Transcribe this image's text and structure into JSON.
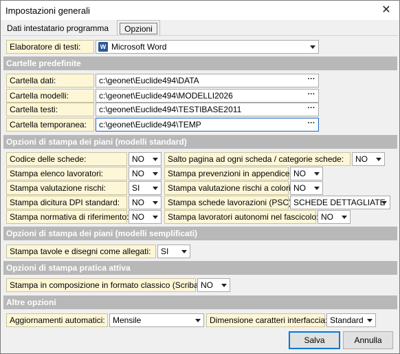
{
  "window": {
    "title": "Impostazioni generali",
    "close_glyph": "✕"
  },
  "tabs": [
    {
      "label": "Dati intestatario programma"
    },
    {
      "label": "Opzioni"
    }
  ],
  "editor": {
    "label": "Elaboratore di testi:",
    "value": "Microsoft Word",
    "icon": "word-icon",
    "icon_glyph": "W"
  },
  "sections": {
    "folders": "Cartelle predefinite",
    "print_standard": "Opzioni di stampa dei piani (modelli standard)",
    "print_simplified": "Opzioni di stampa dei piani (modelli semplificati)",
    "print_practice": "Opzioni di stampa pratica attiva",
    "other": "Altre opzioni"
  },
  "folders": [
    {
      "label": "Cartella dati:",
      "value": "c:\\geonet\\Euclide494\\DATA"
    },
    {
      "label": "Cartella modelli:",
      "value": "c:\\geonet\\Euclide494\\MODELLI2026"
    },
    {
      "label": "Cartella testi:",
      "value": "c:\\geonet\\Euclide494\\TESTIBASE2011"
    },
    {
      "label": "Cartella temporanea:",
      "value": "c:\\geonet\\Euclide494\\TEMP"
    }
  ],
  "browse_glyph": "···",
  "print_standard": {
    "left": [
      {
        "label": "Codice delle schede:",
        "value": "NO"
      },
      {
        "label": "Stampa elenco lavoratori:",
        "value": "NO"
      },
      {
        "label": "Stampa valutazione rischi:",
        "value": "SI"
      },
      {
        "label": "Stampa dicitura DPI standard:",
        "value": "NO"
      },
      {
        "label": "Stampa normativa di riferimento:",
        "value": "NO"
      }
    ],
    "right": [
      {
        "label": "Salto pagina ad ogni scheda / categorie schede:",
        "value": "NO"
      },
      {
        "label": "Stampa prevenzioni in appendice:",
        "value": "NO"
      },
      {
        "label": "Stampa valutazione rischi a colori:",
        "value": "NO"
      },
      {
        "label": "Stampa schede lavorazioni (PSC):",
        "value": "SCHEDE DETTAGLIATE"
      },
      {
        "label": "Stampa lavoratori autonomi nel fascicolo:",
        "value": "NO"
      }
    ]
  },
  "print_simplified": {
    "label": "Stampa tavole e disegni come allegati:",
    "value": "SI"
  },
  "print_practice": {
    "label": "Stampa in composizione in formato classico (Scriba):",
    "value": "NO"
  },
  "other": {
    "updates": {
      "label": "Aggiornamenti automatici:",
      "value": "Mensile"
    },
    "font_size": {
      "label": "Dimensione caratteri interfaccia:",
      "value": "Standard"
    }
  },
  "buttons": {
    "save": "Salva",
    "cancel": "Annulla"
  }
}
